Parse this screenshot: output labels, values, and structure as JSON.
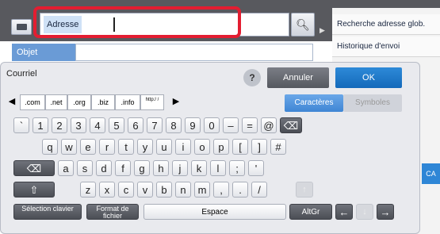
{
  "address": {
    "label": "Adresse"
  },
  "subject": {
    "label": "Objet"
  },
  "side_menu": [
    "Recherche adresse glob.",
    "Historique d'envoi"
  ],
  "panel": {
    "title": "Courriel",
    "cancel": "Annuler",
    "ok": "OK"
  },
  "domains": [
    ".com",
    ".net",
    ".org",
    ".biz",
    ".info",
    "http:/ /"
  ],
  "modes": {
    "characters": "Caractères",
    "symbols": "Symboles"
  },
  "rows": {
    "r1": [
      "`",
      "1",
      "2",
      "3",
      "4",
      "5",
      "6",
      "7",
      "8",
      "9",
      "0",
      "–",
      "=",
      "@"
    ],
    "r2": [
      "q",
      "w",
      "e",
      "r",
      "t",
      "y",
      "u",
      "i",
      "o",
      "p",
      "[",
      "]",
      "#"
    ],
    "r3": [
      "a",
      "s",
      "d",
      "f",
      "g",
      "h",
      "j",
      "k",
      "l",
      ";",
      "'"
    ],
    "r4": [
      "z",
      "x",
      "c",
      "v",
      "b",
      "n",
      "m",
      ",",
      ".",
      "/"
    ]
  },
  "bottom": {
    "select": "Sélection clavier",
    "format": "Format de fichier",
    "space": "Espace",
    "altgr": "AltGr"
  },
  "side_tab": "CA"
}
